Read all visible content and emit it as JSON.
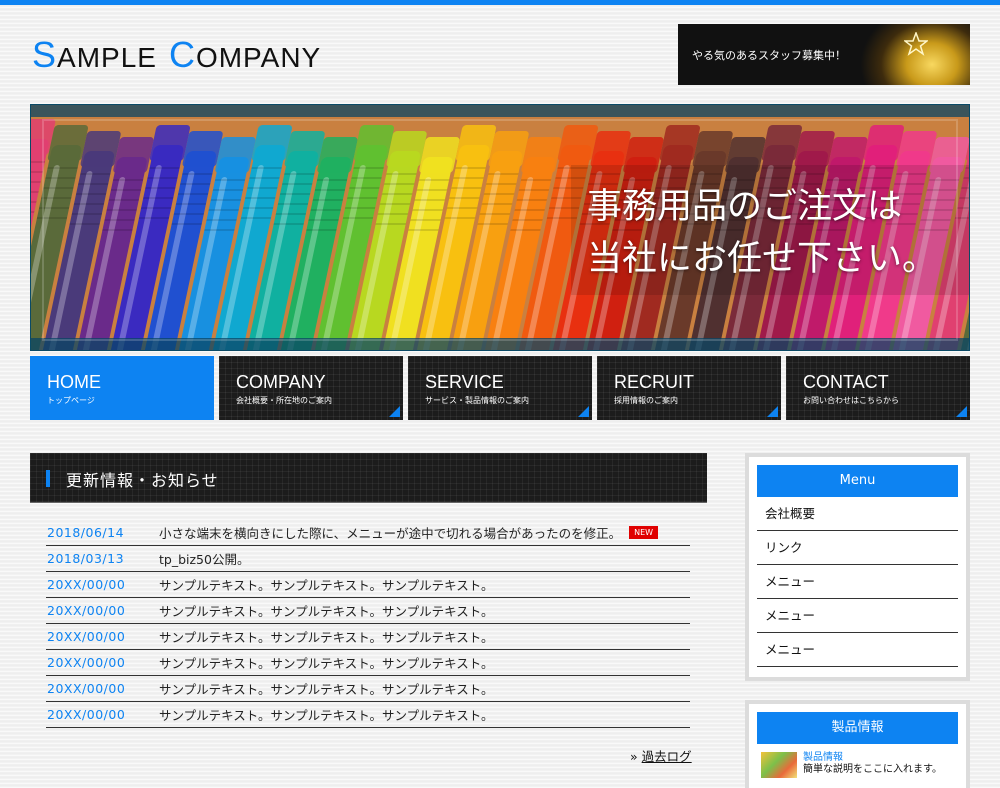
{
  "logo": {
    "s": "S",
    "ample": "AMPLE",
    "c": "C",
    "ompany": "OMPANY"
  },
  "recruit_banner": {
    "text": "やる気のあるスタッフ募集中！"
  },
  "hero": {
    "line1": "事務用品のご注文は",
    "line2": "当社にお任せ下さい。"
  },
  "nav": [
    {
      "en": "HOME",
      "jp": "トップページ"
    },
    {
      "en": "COMPANY",
      "jp": "会社概要・所在地のご案内"
    },
    {
      "en": "SERVICE",
      "jp": "サービス・製品情報のご案内"
    },
    {
      "en": "RECRUIT",
      "jp": "採用情報のご案内"
    },
    {
      "en": "CONTACT",
      "jp": "お問い合わせはこちらから"
    }
  ],
  "news": {
    "title": "更新情報・お知らせ",
    "items": [
      {
        "date": "2018/06/14",
        "text": "小さな端末を横向きにした際に、メニューが途中で切れる場合があったのを修正。",
        "badge": "NEW"
      },
      {
        "date": "2018/03/13",
        "text": "tp_biz50公開。"
      },
      {
        "date": "20XX/00/00",
        "text": "サンプルテキスト。サンプルテキスト。サンプルテキスト。"
      },
      {
        "date": "20XX/00/00",
        "text": "サンプルテキスト。サンプルテキスト。サンプルテキスト。"
      },
      {
        "date": "20XX/00/00",
        "text": "サンプルテキスト。サンプルテキスト。サンプルテキスト。"
      },
      {
        "date": "20XX/00/00",
        "text": "サンプルテキスト。サンプルテキスト。サンプルテキスト。"
      },
      {
        "date": "20XX/00/00",
        "text": "サンプルテキスト。サンプルテキスト。サンプルテキスト。"
      },
      {
        "date": "20XX/00/00",
        "text": "サンプルテキスト。サンプルテキスト。サンプルテキスト。"
      }
    ],
    "past_log_prefix": "»",
    "past_log_label": "過去ログ"
  },
  "sidebar": {
    "menu_title": "Menu",
    "menu_items": [
      "会社概要",
      "リンク",
      "メニュー",
      "メニュー",
      "メニュー"
    ],
    "products_title": "製品情報",
    "product": {
      "link": "製品情報",
      "desc": "簡単な説明をここに入れます。"
    }
  },
  "colors": {
    "accent": "#0d83f2",
    "dark": "#1c1c1c",
    "badge": "#e00000"
  }
}
